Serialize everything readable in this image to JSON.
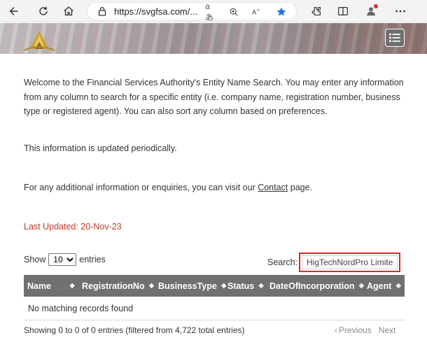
{
  "browser": {
    "url": "https://svgfsa.com/...",
    "reader_label": "aあ",
    "icons": [
      "back-arrow-icon",
      "refresh-icon",
      "home-icon",
      "lock-icon",
      "read-aloud-icon",
      "zoom-icon",
      "immersive-reader-icon",
      "favorite-star-icon",
      "extensions-icon",
      "split-screen-icon",
      "profile-icon",
      "more-icon"
    ]
  },
  "header": {
    "menu_icon": "hamburger-list-icon"
  },
  "intro": {
    "paragraph": "Welcome to the Financial Services Authority's Entity Name Search. You may enter any information from any column to search for a specific entity (i.e. company name, registration number, business type or registered agent). You can also sort any column based on preferences.",
    "periodic": "This information is updated periodically.",
    "contact_prefix": "For any additional information or enquiries, you can visit our ",
    "contact_link": "Contact",
    "contact_suffix": " page.",
    "last_updated": "Last Updated:  20-Nov-23"
  },
  "table_controls": {
    "show_label": "Show",
    "entries_label": "entries",
    "page_size": "10",
    "search_label": "Search:",
    "search_value": "HigTechNordPro Limite"
  },
  "table": {
    "columns": [
      "Name",
      "RegistrationNo",
      "BusinessType",
      "Status",
      "DateOfIncorporation",
      "Agent"
    ],
    "sort_glyph": "◆",
    "empty_message": "No matching records found",
    "info": "Showing 0 to 0 of 0 entries (filtered from 4,722 total entries)",
    "previous": "Previous",
    "next": "Next"
  },
  "colors": {
    "header_bg": "#707070",
    "accent_red": "#c0392b",
    "highlight_border": "#e02424"
  }
}
